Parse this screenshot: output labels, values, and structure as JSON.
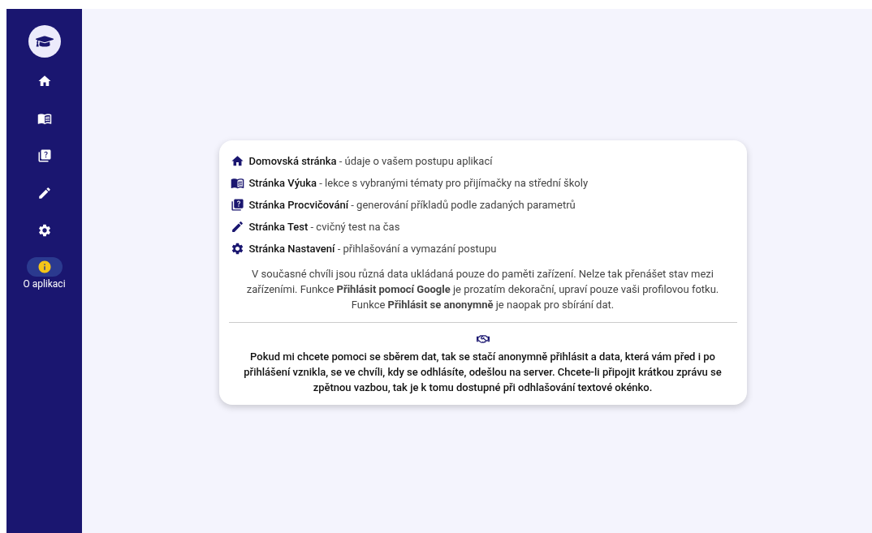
{
  "sidebar": {
    "items": [
      {
        "kind": "home",
        "selected": false
      },
      {
        "kind": "lessons",
        "selected": false
      },
      {
        "kind": "practice",
        "selected": false
      },
      {
        "kind": "test",
        "selected": false
      },
      {
        "kind": "settings",
        "selected": false
      },
      {
        "kind": "about",
        "selected": true,
        "label": "O aplikaci"
      }
    ]
  },
  "card": {
    "features": [
      {
        "kind": "home",
        "title": "Domovská stránka",
        "description": " - údaje o vašem postupu aplikací"
      },
      {
        "kind": "lessons",
        "title": "Stránka Výuka",
        "description": " - lekce s vybranými tématy pro přijímačky na střední školy"
      },
      {
        "kind": "practice",
        "title": "Stránka Procvičování",
        "description": " - generování příkladů podle zadaných parametrů"
      },
      {
        "kind": "test",
        "title": "Stránka Test",
        "description": " - cvičný test na čas"
      },
      {
        "kind": "settings",
        "title": "Stránka Nastavení",
        "description": " - přihlašování a vymazání postupu"
      }
    ],
    "note": "V současné chvíli jsou různá data ukládaná pouze do paměti zařízení. Nelze tak přenášet stav mezi zařízeními. Funkce **Přihlásit pomocí Google** je prozatím dekorační, upraví pouze vaši profilovou fotku. Funkce **Přihlásit se anonymně** je naopak pro sbírání dat.",
    "appeal": "Pokud mi chcete pomoci se sběrem dat, tak se stačí anonymně přihlásit a data, která vám před i po přihlášení vznikla, se ve chvíli, kdy se odhlásíte, odešlou na server. Chcete-li připojit krátkou zprávu se zpětnou vazbou, tak je k tomu dostupné při odhlašování textové okénko."
  }
}
